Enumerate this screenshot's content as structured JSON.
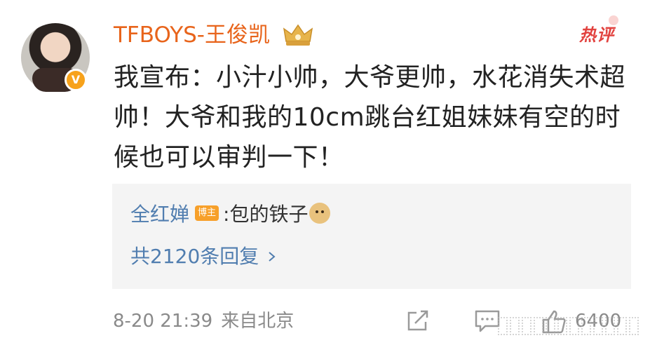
{
  "post": {
    "author": "TFBOYS-王俊凯",
    "hot_label": "热评",
    "verified_badge": "V",
    "content": "我宣布：小汁小帅，大爷更帅，水花消失术超帅！大爷和我的10cm跳台红姐妹妹有空的时候也可以审判一下！"
  },
  "reply_preview": {
    "user": "全红婵",
    "tag": "博主",
    "separator": ":",
    "text": "包的铁子",
    "emoji_icon": "doge-emoji-icon",
    "more_replies": "共2120条回复"
  },
  "footer": {
    "time": "8-20 21:39",
    "source": "来自北京",
    "like_count": "6400"
  },
  "colors": {
    "author": "#e8641b",
    "hot": "#e2423f",
    "link": "#507daf",
    "meta": "#8a8a8a",
    "reply_bg": "#f4f4f4"
  }
}
